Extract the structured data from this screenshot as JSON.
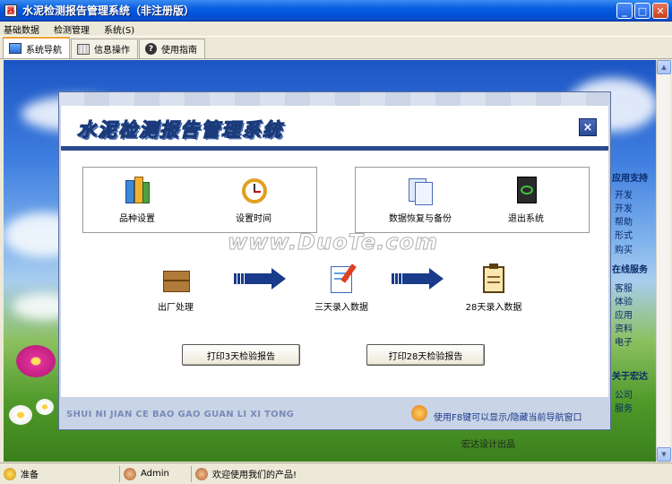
{
  "window": {
    "title": "水泥检测报告管理系统（非注册版）"
  },
  "menu": [
    "基础数据",
    "检测管理",
    "系统(S)"
  ],
  "tabs": [
    {
      "label": "系统导航",
      "icon": "monitor-icon",
      "active": true
    },
    {
      "label": "信息操作",
      "icon": "grid-icon",
      "active": false
    },
    {
      "label": "使用指南",
      "icon": "help-icon",
      "active": false
    }
  ],
  "dialog": {
    "banner_title": "水泥检测报告管理系统",
    "close_label": "×",
    "group1": [
      {
        "label": "品种设置",
        "icon": "books-icon"
      },
      {
        "label": "设置时间",
        "icon": "alarm-clock-icon"
      }
    ],
    "group2": [
      {
        "label": "数据恢复与备份",
        "icon": "documents-icon"
      },
      {
        "label": "退出系统",
        "icon": "exit-icon"
      }
    ],
    "workflow": [
      {
        "label": "出厂处理",
        "icon": "boxes-icon"
      },
      {
        "label": "三天录入数据",
        "icon": "notepad-icon"
      },
      {
        "label": "28天录入数据",
        "icon": "clipboard-icon"
      }
    ],
    "print_3": "打印3天检验报告",
    "print_28": "打印28天检验报告",
    "pinyin": "SHUI NI JIAN CE BAO GAO GUAN LI XI TONG",
    "f8_hint": "使用F8键可以显示/隐藏当前导航窗口"
  },
  "watermark": "www.DuoTe.com",
  "side_panel": {
    "heading1": "应用支持",
    "items1": [
      "开发",
      "开发",
      "帮助",
      "形式",
      "购买"
    ],
    "heading2": "在线服务",
    "items2": [
      "客服",
      "体验",
      "应用",
      "资料",
      "电子"
    ],
    "heading3": "关于宏达",
    "items3": [
      "公司",
      "服务"
    ]
  },
  "bottom_note": "宏达设计出品",
  "status": {
    "ready": "准备",
    "user": "Admin",
    "welcome": "欢迎使用我们的产品!"
  },
  "colors": {
    "accent": "#2b4a90",
    "titlebar": "#0a5fe0"
  }
}
